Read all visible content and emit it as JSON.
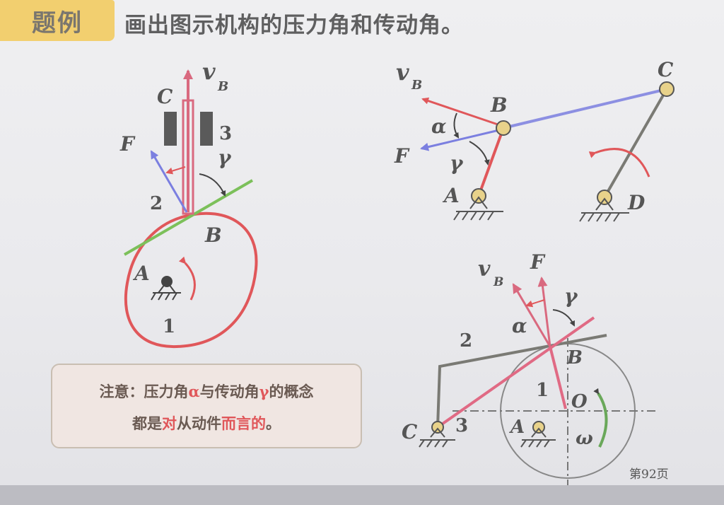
{
  "header": {
    "tag": "题例",
    "title": "画出图示机构的压力角和传动角。"
  },
  "note": {
    "line1_a": "注意：压力角",
    "line1_alpha": "α",
    "line1_b": "与传动角",
    "line1_gamma": "γ",
    "line1_c": "的概念",
    "line2_a": "都是",
    "line2_red1": "对",
    "line2_b": "从动件",
    "line2_red2": "而言的",
    "line2_c": "。"
  },
  "page_number": "第92页",
  "diagram_cam": {
    "labels": {
      "vB_v": "v",
      "vB_sub": "B",
      "C": "C",
      "num3": "3",
      "F": "F",
      "gamma": "γ",
      "num2": "2",
      "B": "B",
      "A": "A",
      "num1": "1"
    }
  },
  "diagram_linkage": {
    "labels": {
      "vB_v": "v",
      "vB_sub": "B",
      "B": "B",
      "C": "C",
      "alpha": "α",
      "F": "F",
      "gamma": "γ",
      "A": "A",
      "D": "D"
    }
  },
  "diagram_slider": {
    "labels": {
      "vB_v": "v",
      "vB_sub": "B",
      "F": "F",
      "gamma": "γ",
      "alpha": "α",
      "num2": "2",
      "B": "B",
      "num1": "1",
      "O": "O",
      "C": "C",
      "num3": "3",
      "A": "A",
      "omega": "ω"
    }
  },
  "colors": {
    "header_tag": "#f2cf6f",
    "red": "#e0575a",
    "blue": "#7b7fe0",
    "green": "#7cc05a",
    "link_gray": "#7a7a74",
    "pin": "#d8b45a"
  }
}
